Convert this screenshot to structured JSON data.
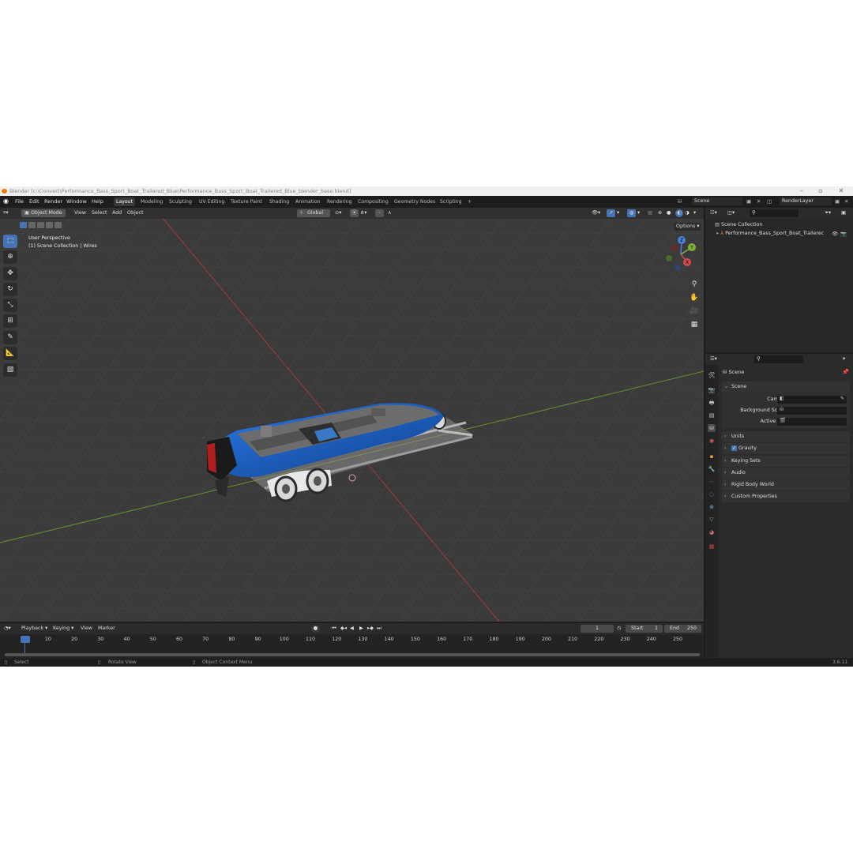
{
  "window": {
    "title": "Blender [c:\\Convert\\Performance_Bass_Sport_Boat_Trailered_Blue\\Performance_Bass_Sport_Boat_Trailered_Blue_blender_base.blend]"
  },
  "menu": [
    "File",
    "Edit",
    "Render",
    "Window",
    "Help"
  ],
  "workspaces": [
    "Layout",
    "Modeling",
    "Sculpting",
    "UV Editing",
    "Texture Paint",
    "Shading",
    "Animation",
    "Rendering",
    "Compositing",
    "Geometry Nodes",
    "Scripting",
    "+"
  ],
  "top_right": {
    "scene": "Scene",
    "render_layer": "RenderLayer"
  },
  "viewport_header": {
    "mode": "Object Mode",
    "menus": [
      "View",
      "Select",
      "Add",
      "Object"
    ],
    "orientation": "Global",
    "options": "Options"
  },
  "viewport": {
    "perspective": "User Perspective",
    "collection": "(1) Scene Collection | Wires"
  },
  "gizmo": {
    "z": "Z",
    "y": "Y",
    "x": "X"
  },
  "outliner": {
    "root": "Scene Collection",
    "object": "Performance_Bass_Sport_Boat_Trailerec"
  },
  "properties": {
    "tab_title": "Scene",
    "panel_scene": "Scene",
    "camera_label": "Camera",
    "background_label": "Background Scene",
    "clip_label": "Active Clip",
    "panels": [
      "Units",
      "Gravity",
      "Keying Sets",
      "Audio",
      "Rigid Body World",
      "Custom Properties"
    ],
    "gravity_checked": true
  },
  "timeline": {
    "menus": [
      "Playback",
      "Keying",
      "View",
      "Marker"
    ],
    "current_frame": "1",
    "start_label": "Start",
    "start": "1",
    "end_label": "End",
    "end": "250",
    "ticks": [
      "1",
      "10",
      "20",
      "30",
      "40",
      "50",
      "60",
      "70",
      "80",
      "90",
      "100",
      "110",
      "120",
      "130",
      "140",
      "150",
      "160",
      "170",
      "180",
      "190",
      "200",
      "210",
      "220",
      "230",
      "240",
      "250"
    ]
  },
  "status": {
    "select": "Select",
    "rotate": "Rotate View",
    "context": "Object Context Menu",
    "version": "3.6.11"
  },
  "colors": {
    "accent": "#4772b3",
    "boat_blue": "#1e63c7",
    "x_axis": "#c23a3a",
    "y_axis": "#6c9a2a"
  }
}
